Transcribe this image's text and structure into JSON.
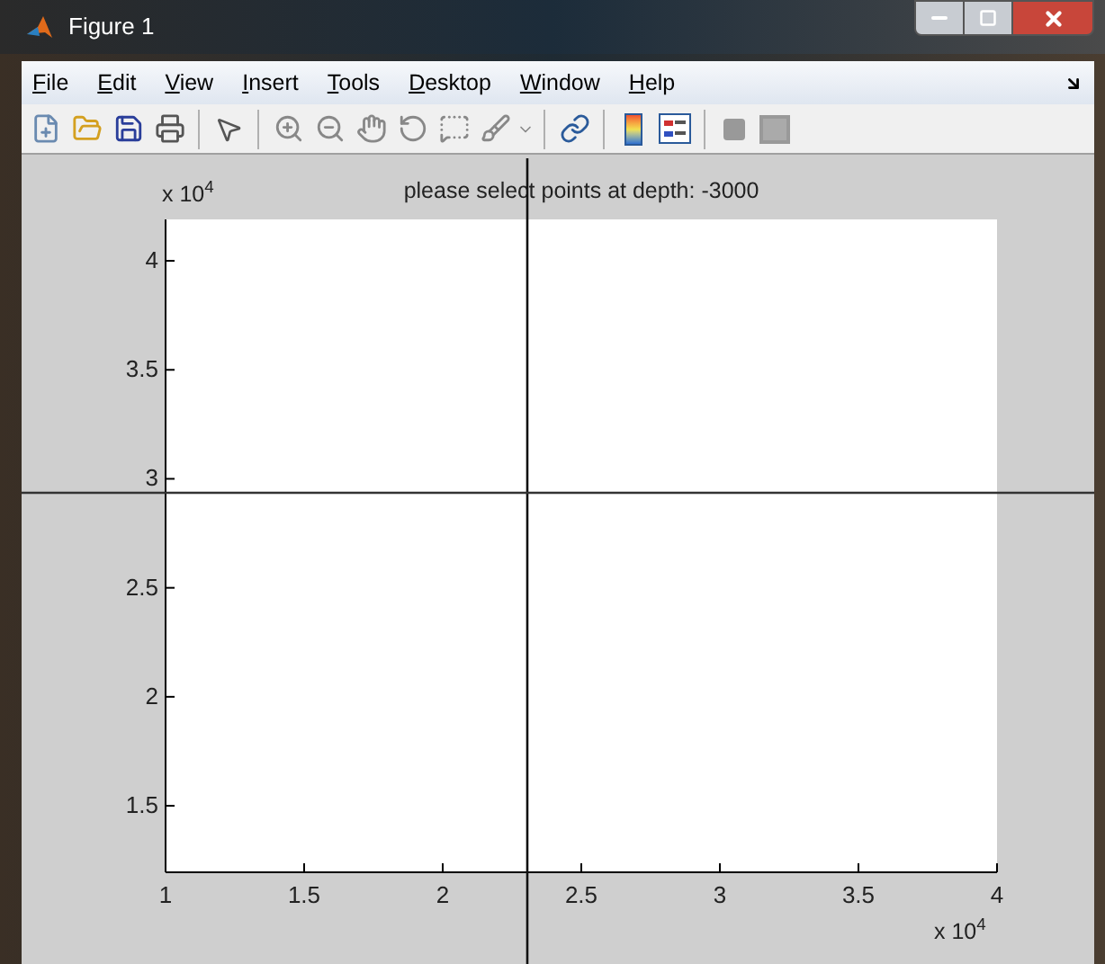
{
  "window": {
    "title": "Figure 1"
  },
  "menu": [
    "File",
    "Edit",
    "View",
    "Insert",
    "Tools",
    "Desktop",
    "Window",
    "Help"
  ],
  "figure": {
    "chart_data": {
      "type": "scatter",
      "title": "please select points at depth: -3000",
      "xlim": [
        1,
        4
      ],
      "ylim": [
        1.195,
        4.19
      ],
      "xticks": [
        {
          "value": 1,
          "label": "1"
        },
        {
          "value": 1.5,
          "label": "1.5"
        },
        {
          "value": 2,
          "label": "2"
        },
        {
          "value": 2.5,
          "label": "2.5"
        },
        {
          "value": 3,
          "label": "3"
        },
        {
          "value": 3.5,
          "label": "3.5"
        },
        {
          "value": 4,
          "label": "4"
        }
      ],
      "yticks": [
        {
          "value": 1.5,
          "label": "1.5"
        },
        {
          "value": 2,
          "label": "2"
        },
        {
          "value": 2.5,
          "label": "2.5"
        },
        {
          "value": 3,
          "label": "3"
        },
        {
          "value": 3.5,
          "label": "3.5"
        },
        {
          "value": 4,
          "label": "4"
        }
      ],
      "annotations": [
        "x 10$^{4}$",
        "x 10$^{4}$"
      ]
    }
  }
}
